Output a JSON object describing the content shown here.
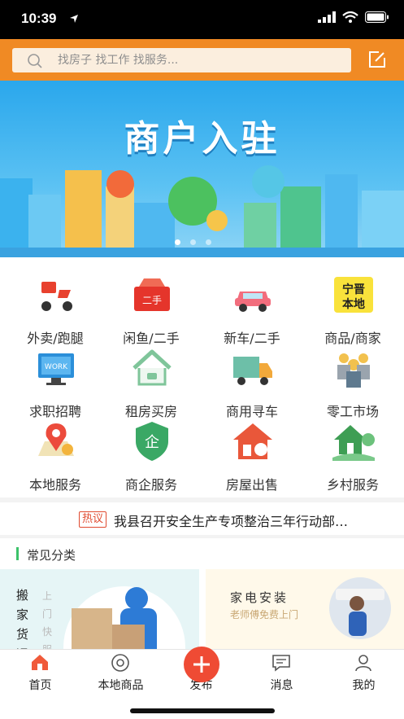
{
  "status_bar": {
    "time": "10:39"
  },
  "search": {
    "placeholder": "找房子 找工作 找服务..."
  },
  "banner": {
    "title": "商户入驻",
    "dots": 3,
    "active_dot": 0
  },
  "categories": [
    {
      "label": "外卖/跑腿",
      "icon": "scooter-icon"
    },
    {
      "label": "闲鱼/二手",
      "icon": "secondhand-box-icon",
      "icon_text": "二手"
    },
    {
      "label": "新车/二手",
      "icon": "car-icon"
    },
    {
      "label": "商品/商家",
      "icon": "local-badge-icon",
      "icon_text": "宁晋本地"
    },
    {
      "label": "求职招聘",
      "icon": "work-monitor-icon",
      "icon_text": "WORK"
    },
    {
      "label": "租房买房",
      "icon": "house-outline-icon"
    },
    {
      "label": "商用寻车",
      "icon": "truck-icon"
    },
    {
      "label": "零工市场",
      "icon": "workers-group-icon"
    },
    {
      "label": "本地服务",
      "icon": "map-pin-icon"
    },
    {
      "label": "商企服务",
      "icon": "enterprise-shield-icon",
      "icon_text": "企"
    },
    {
      "label": "房屋出售",
      "icon": "house-sale-icon"
    },
    {
      "label": "乡村服务",
      "icon": "rural-house-icon"
    }
  ],
  "news": {
    "tag": "热议",
    "text": "我县召开安全生产专项整治三年行动部…"
  },
  "section": {
    "title": "常见分类"
  },
  "cards": {
    "left": {
      "title": "搬家货运",
      "subtitle": "上门快服"
    },
    "right": {
      "title": "家电安装",
      "subtitle": "老师傅免费上门"
    }
  },
  "tabs": [
    {
      "label": "首页",
      "icon": "home-icon",
      "active": true
    },
    {
      "label": "本地商品",
      "icon": "disc-icon"
    },
    {
      "label": "发布",
      "icon": "plus-icon"
    },
    {
      "label": "消息",
      "icon": "message-icon"
    },
    {
      "label": "我的",
      "icon": "user-icon"
    }
  ],
  "colors": {
    "header": "#f08a24",
    "banner": "#2aa7ec",
    "hot": "#e04a2f",
    "publish": "#ef4b34",
    "accent_green": "#3cc26a"
  }
}
